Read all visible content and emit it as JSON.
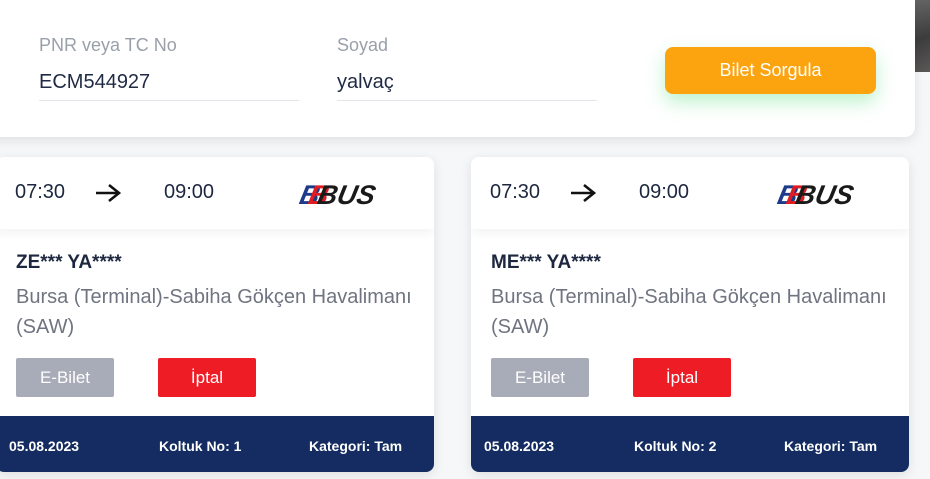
{
  "search": {
    "pnr_label": "PNR veya TC No",
    "pnr_value": "ECM544927",
    "surname_label": "Soyad",
    "surname_value": "yalvaç",
    "query_button": "Bilet Sorgula"
  },
  "tickets": [
    {
      "departure": "07:30",
      "arrival": "09:00",
      "brand_logo": "BBBUS",
      "passenger": "ZE*** YA****",
      "route": "Bursa (Terminal)-Sabiha Gökçen Havalimanı (SAW)",
      "ebilet_button": "E-Bilet",
      "iptal_button": "İptal",
      "date": "05.08.2023",
      "seat": "Koltuk No: 1",
      "category": "Kategori: Tam"
    },
    {
      "departure": "07:30",
      "arrival": "09:00",
      "brand_logo": "BBBUS",
      "passenger": "ME*** YA****",
      "route": "Bursa (Terminal)-Sabiha Gökçen Havalimanı (SAW)",
      "ebilet_button": "E-Bilet",
      "iptal_button": "İptal",
      "date": "05.08.2023",
      "seat": "Koltuk No: 2",
      "category": "Kategori: Tam"
    }
  ],
  "colors": {
    "accent_orange": "#fca310",
    "cancel_red": "#ee1c25",
    "footer_navy": "#142c61",
    "ebilet_gray": "#a8acb8"
  },
  "icons": {
    "arrow": "arrow-right-icon",
    "logo": "bbbus-logo"
  }
}
